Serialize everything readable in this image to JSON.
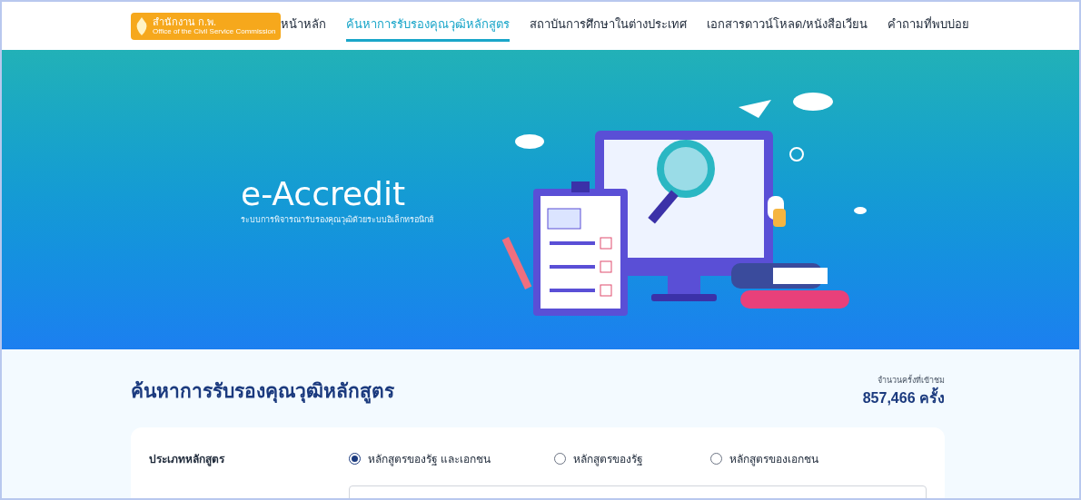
{
  "logo": {
    "title": "สำนักงาน ก.พ.",
    "subtitle": "Office of the Civil Service Commission"
  },
  "nav": [
    {
      "label": "หน้าหลัก",
      "selected": false
    },
    {
      "label": "ค้นหาการรับรองคุณวุฒิหลักสูตร",
      "selected": true
    },
    {
      "label": "สถาบันการศึกษาในต่างประเทศ",
      "selected": false
    },
    {
      "label": "เอกสารดาวน์โหลด/หนังสือเวียน",
      "selected": false
    },
    {
      "label": "คำถามที่พบบ่อย",
      "selected": false
    }
  ],
  "hero": {
    "title": "e-Accredit",
    "subtitle": "ระบบการพิจารณารับรองคุณวุฒิด้วยระบบอิเล็กทรอนิกส์"
  },
  "search": {
    "heading": "ค้นหาการรับรองคุณวุฒิหลักสูตร",
    "visits_label": "จำนวนครั้งที่เข้าชม",
    "visits": "857,466 ครั้ง",
    "form": {
      "label": "ประเภทหลักสูตร",
      "options": [
        {
          "label": "หลักสูตรของรัฐ และเอกชน",
          "selected": true
        },
        {
          "label": "หลักสูตรของรัฐ",
          "selected": false
        },
        {
          "label": "หลักสูตรของเอกชน",
          "selected": false
        }
      ]
    }
  }
}
